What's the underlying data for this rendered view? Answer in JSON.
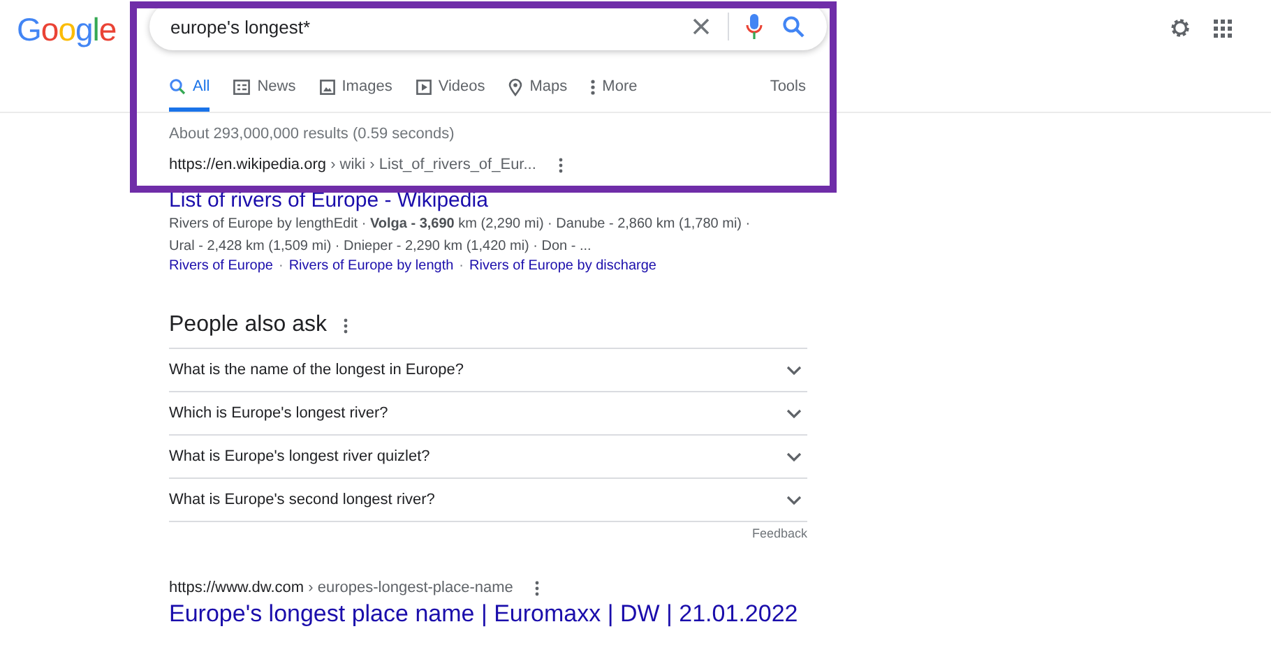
{
  "logo": "Google",
  "search": {
    "value": "europe's longest*"
  },
  "tabs": [
    {
      "label": "All",
      "selected": true
    },
    {
      "label": "News",
      "selected": false
    },
    {
      "label": "Images",
      "selected": false
    },
    {
      "label": "Videos",
      "selected": false
    },
    {
      "label": "Maps",
      "selected": false
    },
    {
      "label": "More",
      "selected": false
    }
  ],
  "tools": "Tools",
  "result_stats": "About 293,000,000 results (0.59 seconds)",
  "results": [
    {
      "url_host": "https://en.wikipedia.org",
      "url_path": "› wiki › List_of_rivers_of_Eur...",
      "title": "List of rivers of Europe - Wikipedia",
      "snippet": "Rivers of Europe by lengthEdit · **Volga - 3,690** km (2,290 mi) · Danube - 2,860 km (1,780 mi) · Ural - 2,428 km (1,509 mi) · Dnieper - 2,290 km (1,420 mi) · Don - ...",
      "sitelink_separator": "·",
      "sitelinks": [
        "Rivers of Europe",
        "Rivers of Europe by length",
        "Rivers of Europe by discharge"
      ]
    }
  ],
  "people_also_ask": {
    "heading": "People also ask",
    "questions": [
      {
        "text": "What is the name of the longest in Europe?",
        "expanded": false
      },
      {
        "text": "Which is Europe's longest river?",
        "expanded": false
      },
      {
        "text": "What is Europe's longest river quizlet?",
        "expanded": false
      },
      {
        "text": "What is Europe's second longest river?",
        "expanded": false
      }
    ],
    "feedback": "Feedback"
  },
  "results_after": [
    {
      "url_host": "https://www.dw.com",
      "url_path": "› europes-longest-place-name",
      "title": "Europe's longest place name | Euromaxx | DW | 21.01.2022"
    }
  ]
}
